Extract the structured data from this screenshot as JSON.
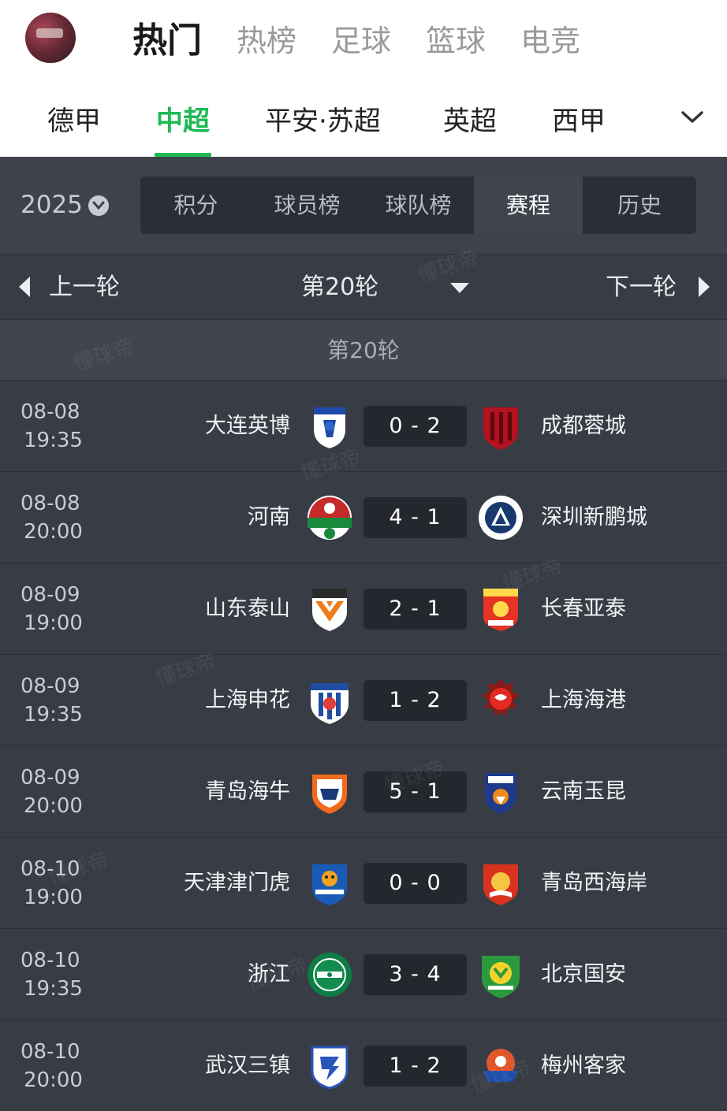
{
  "top_tabs": [
    "热门",
    "热榜",
    "足球",
    "篮球",
    "电竞"
  ],
  "top_tabs_active": 0,
  "league_tabs": [
    "德甲",
    "中超",
    "平安·苏超",
    "英超",
    "西甲"
  ],
  "league_tabs_active": 1,
  "season": "2025",
  "segments": [
    "积分",
    "球员榜",
    "球队榜",
    "赛程",
    "历史"
  ],
  "segments_active": 3,
  "round_nav": {
    "prev": "上一轮",
    "current": "第20轮",
    "next": "下一轮"
  },
  "round_header": "第20轮",
  "watermark": "懂球帝",
  "colors": {
    "accent": "#1db954",
    "panel": "#373c45",
    "score_bg": "#24272d"
  },
  "matches": [
    {
      "date": "08-08",
      "time": "19:35",
      "home": "大连英博",
      "score": "0 - 2",
      "away": "成都蓉城",
      "home_badge": "dalian-yingbo-crest",
      "away_badge": "chengdu-rongcheng-crest"
    },
    {
      "date": "08-08",
      "time": "20:00",
      "home": "河南",
      "score": "4 - 1",
      "away": "深圳新鹏城",
      "home_badge": "henan-crest",
      "away_badge": "shenzhen-peng-city-crest"
    },
    {
      "date": "08-09",
      "time": "19:00",
      "home": "山东泰山",
      "score": "2 - 1",
      "away": "长春亚泰",
      "home_badge": "shandong-taishan-crest",
      "away_badge": "changchun-yatai-crest"
    },
    {
      "date": "08-09",
      "time": "19:35",
      "home": "上海申花",
      "score": "1 - 2",
      "away": "上海海港",
      "home_badge": "shanghai-shenhua-crest",
      "away_badge": "shanghai-port-crest"
    },
    {
      "date": "08-09",
      "time": "20:00",
      "home": "青岛海牛",
      "score": "5 - 1",
      "away": "云南玉昆",
      "home_badge": "qingdao-hainiu-crest",
      "away_badge": "yunnan-yukun-crest"
    },
    {
      "date": "08-10",
      "time": "19:00",
      "home": "天津津门虎",
      "score": "0 - 0",
      "away": "青岛西海岸",
      "home_badge": "tianjin-jinmen-tiger-crest",
      "away_badge": "qingdao-west-coast-crest"
    },
    {
      "date": "08-10",
      "time": "19:35",
      "home": "浙江",
      "score": "3 - 4",
      "away": "北京国安",
      "home_badge": "zhejiang-crest",
      "away_badge": "beijing-guoan-crest"
    },
    {
      "date": "08-10",
      "time": "20:00",
      "home": "武汉三镇",
      "score": "1 - 2",
      "away": "梅州客家",
      "home_badge": "wuhan-three-towns-crest",
      "away_badge": "meizhou-hakka-crest"
    }
  ]
}
